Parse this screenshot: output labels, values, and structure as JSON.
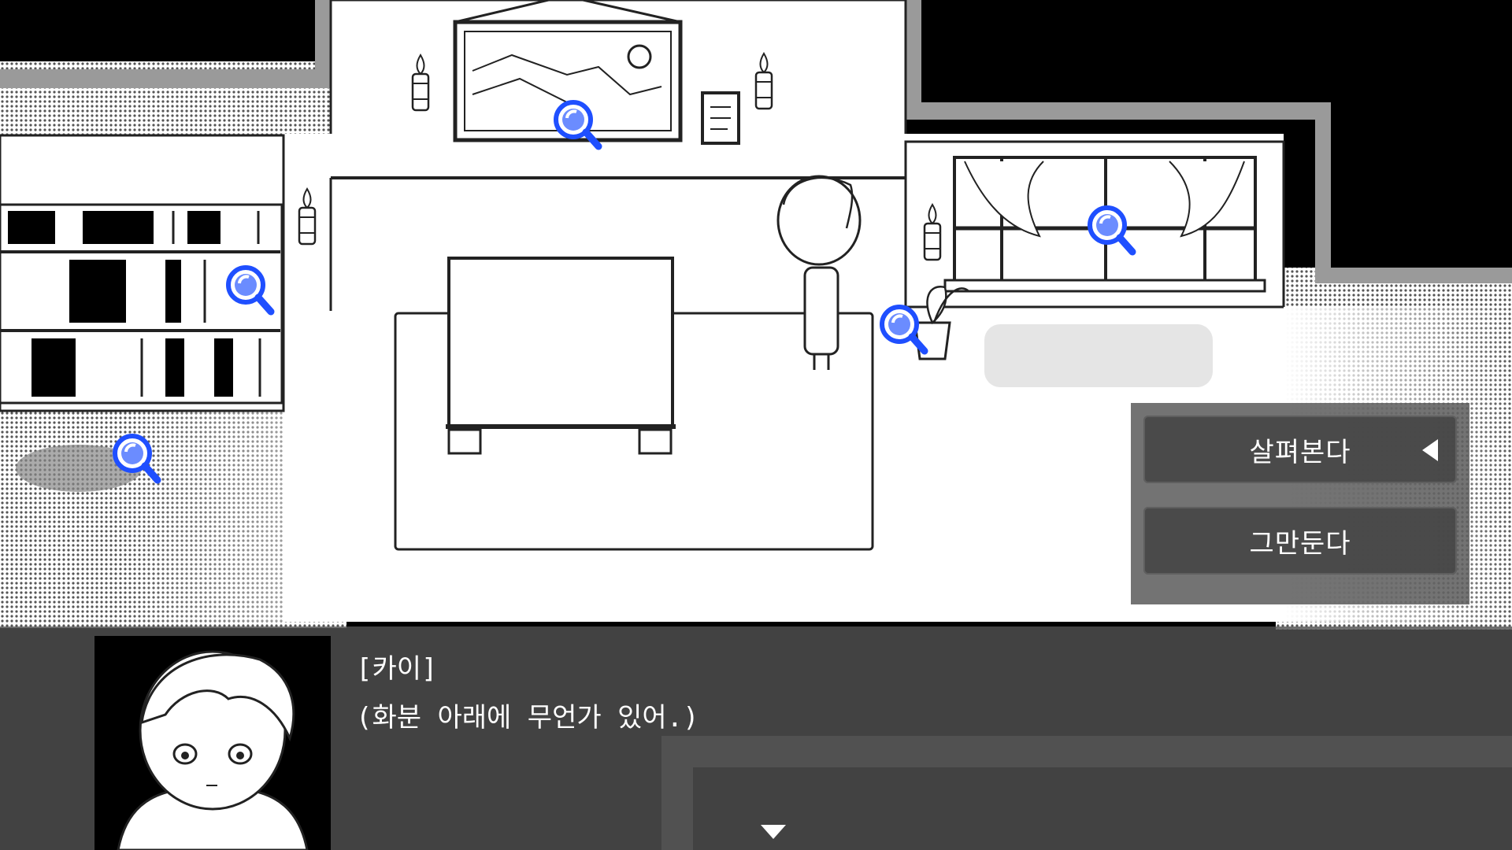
{
  "scene": {
    "location": "living-room",
    "investigate_icon": "magnifier-icon",
    "investigate_color": "#1f4fff",
    "hotspots": [
      "painting",
      "bookshelf",
      "floor-stain",
      "window",
      "flower-pot"
    ]
  },
  "choice_menu": {
    "options": [
      {
        "label": "살펴본다",
        "selected": true
      },
      {
        "label": "그만둔다",
        "selected": false
      }
    ],
    "cursor_icon": "triangle-left-icon"
  },
  "dialogue": {
    "speaker": "[카이]",
    "text": "(화분 아래에 무언가 있어.)",
    "next_icon": "triangle-down-icon"
  },
  "colors": {
    "wall": "#ffffff",
    "floor": "#ffffff",
    "outline": "#222222",
    "dialogue_bg": "#505050",
    "choice_bg": "#5a5a5a"
  }
}
